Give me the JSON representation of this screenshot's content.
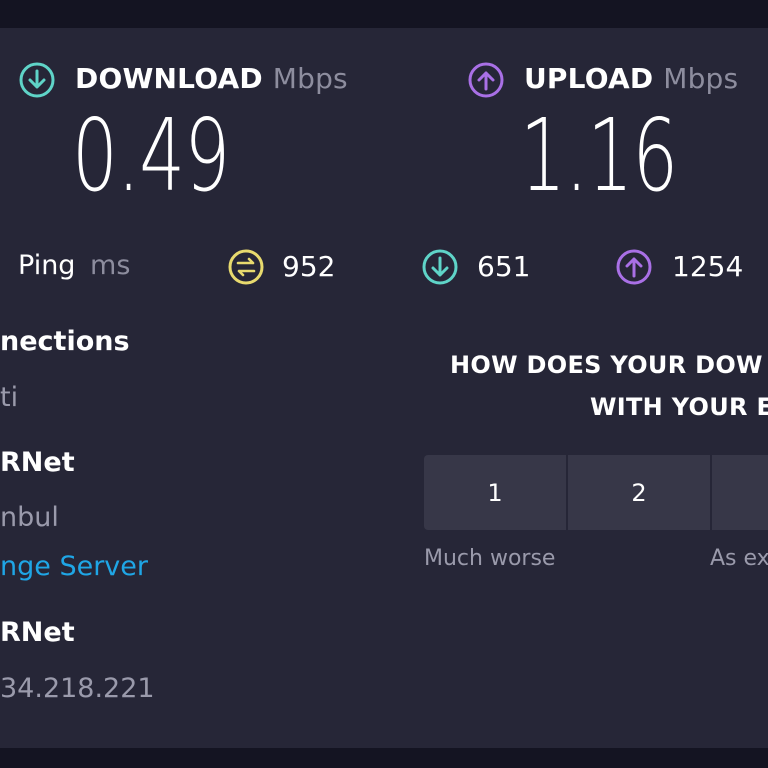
{
  "download": {
    "label": "DOWNLOAD",
    "unit": "Mbps",
    "value": "0.49",
    "icon": "download-arrow-icon",
    "color": "#5fd4c8"
  },
  "upload": {
    "label": "UPLOAD",
    "unit": "Mbps",
    "value": "1.16",
    "icon": "upload-arrow-icon",
    "color": "#a970e6"
  },
  "ping": {
    "label": "Ping",
    "unit": "ms",
    "unloaded": {
      "icon": "ping-idle-icon",
      "value": "952",
      "color": "#e8da6e"
    },
    "download": {
      "icon": "ping-download-icon",
      "value": "651",
      "color": "#5fd4c8"
    },
    "upload": {
      "icon": "ping-upload-icon",
      "value": "1254",
      "color": "#a970e6"
    }
  },
  "connections": {
    "heading": "nections",
    "mode": "ti",
    "server_provider": "RNet",
    "server_city": "nbul",
    "change_server": "nge Server",
    "isp_provider": "RNet",
    "ip": "34.218.221"
  },
  "survey": {
    "question_line1": "HOW DOES YOUR DOW",
    "question_line2": "WITH YOUR E",
    "ratings": [
      "1",
      "2",
      ""
    ],
    "scale_low": "Much worse",
    "scale_mid": "As ex"
  }
}
